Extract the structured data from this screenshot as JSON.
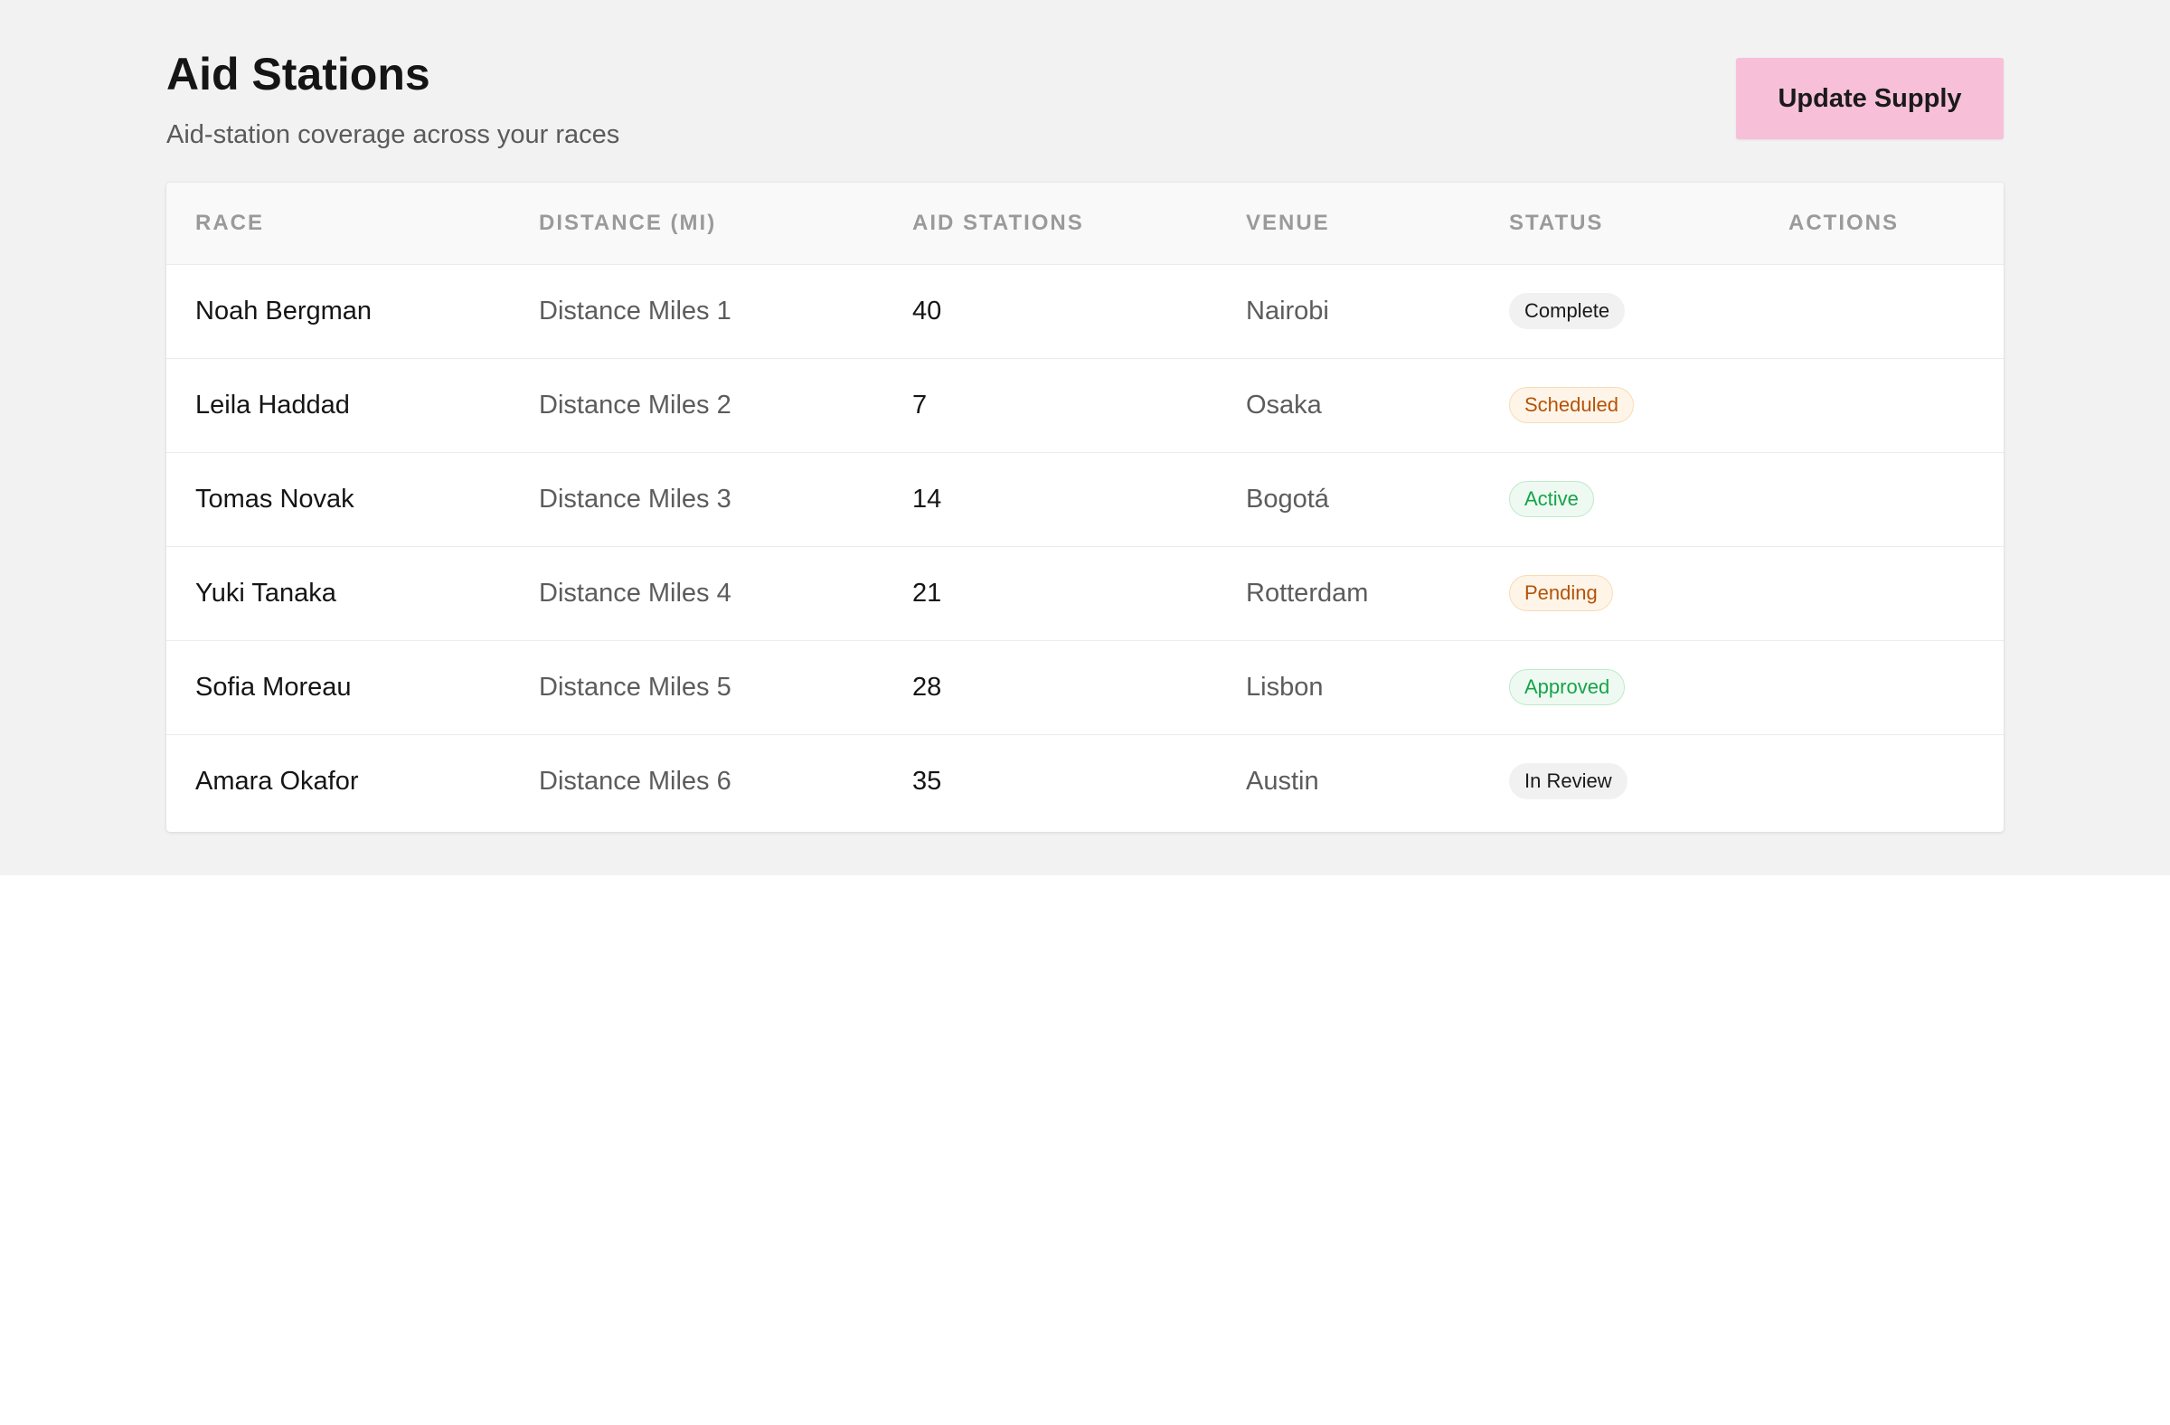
{
  "header": {
    "title": "Aid Stations",
    "subtitle": "Aid-station coverage across your races",
    "update_button": "Update Supply"
  },
  "table": {
    "columns": [
      "Race",
      "Distance (mi)",
      "Aid Stations",
      "Venue",
      "Status",
      "Actions"
    ],
    "rows": [
      {
        "race": "Noah Bergman",
        "distance": "Distance Miles 1",
        "aid_stations": "40",
        "venue": "Nairobi",
        "status": "Complete"
      },
      {
        "race": "Leila Haddad",
        "distance": "Distance Miles 2",
        "aid_stations": "7",
        "venue": "Osaka",
        "status": "Scheduled"
      },
      {
        "race": "Tomas Novak",
        "distance": "Distance Miles 3",
        "aid_stations": "14",
        "venue": "Bogotá",
        "status": "Active"
      },
      {
        "race": "Yuki Tanaka",
        "distance": "Distance Miles 4",
        "aid_stations": "21",
        "venue": "Rotterdam",
        "status": "Pending"
      },
      {
        "race": "Sofia Moreau",
        "distance": "Distance Miles 5",
        "aid_stations": "28",
        "venue": "Lisbon",
        "status": "Approved"
      },
      {
        "race": "Amara Okafor",
        "distance": "Distance Miles 6",
        "aid_stations": "35",
        "venue": "Austin",
        "status": "In Review"
      }
    ]
  },
  "colors": {
    "page_background": "#f2f2f2",
    "button_background": "#f7c0d8",
    "badge_warning_text": "#b45309",
    "badge_success_text": "#16a34a"
  }
}
